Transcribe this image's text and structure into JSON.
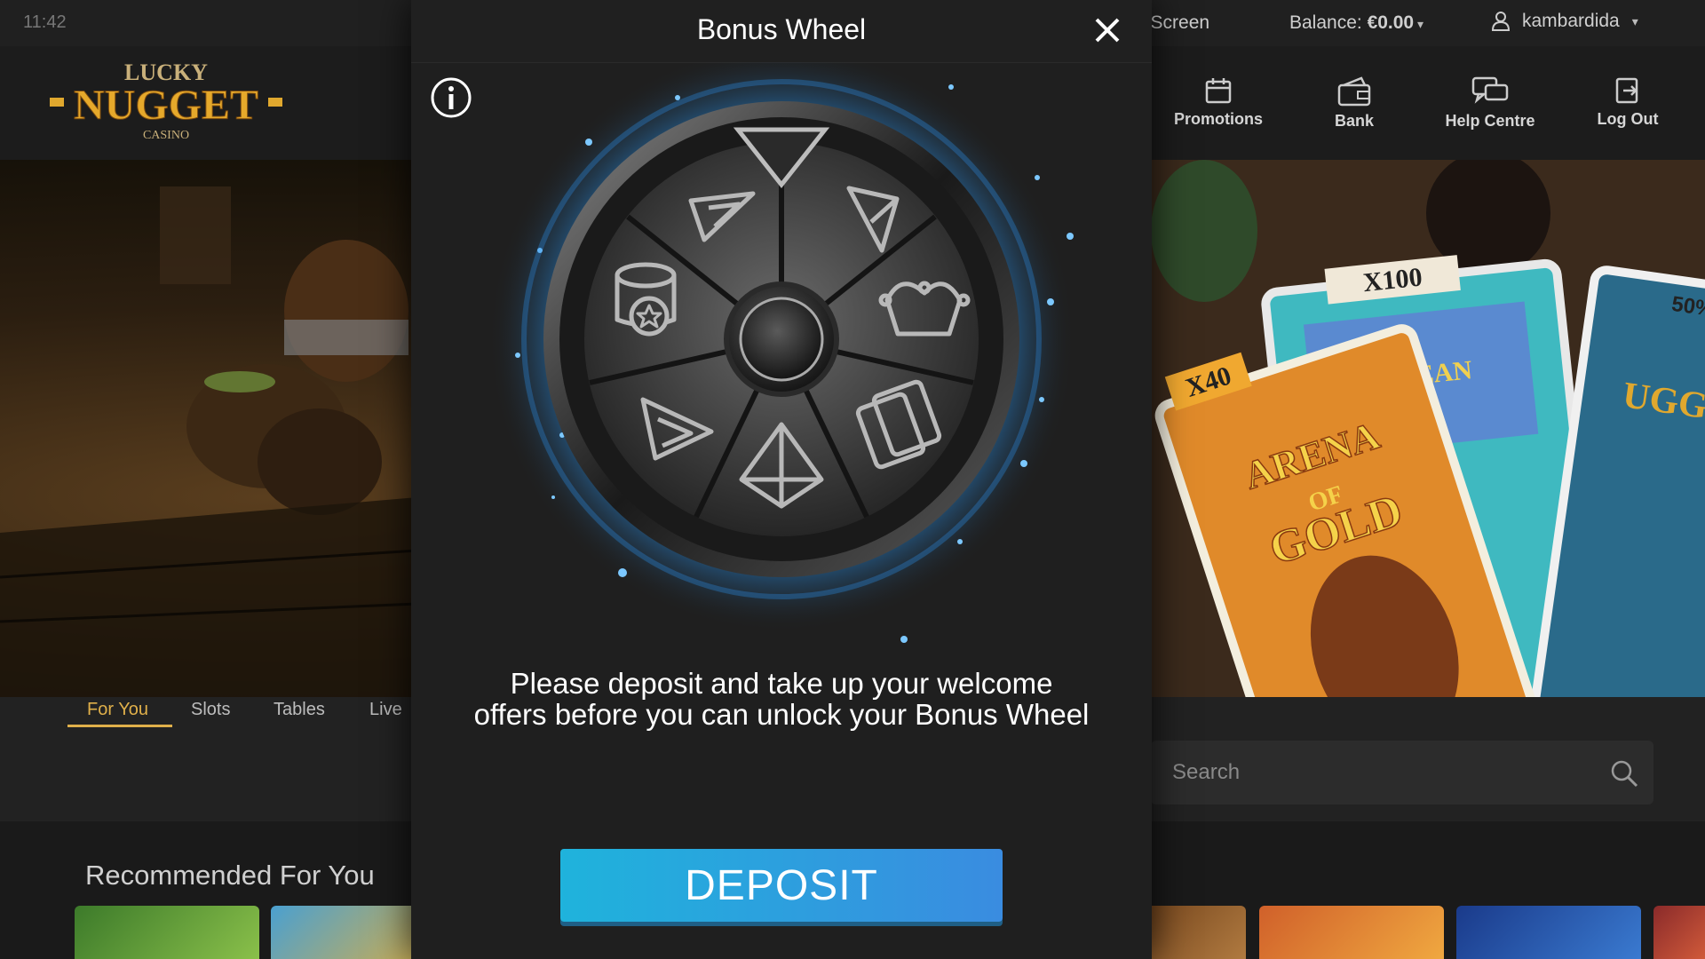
{
  "status_bar": {
    "time": "11:42"
  },
  "top_bar": {
    "screen_link": "e Screen",
    "balance_label": "Balance: ",
    "balance_value": "€0.00",
    "username": "kambardida"
  },
  "logo": {
    "line1": "LUCKY",
    "line2": "NUGGET",
    "line3": "CASINO"
  },
  "nav": {
    "promotions": "Promotions",
    "bank": "Bank",
    "help": "Help Centre",
    "logout": "Log Out"
  },
  "tabs": [
    "For You",
    "Slots",
    "Tables",
    "Live"
  ],
  "search": {
    "placeholder": "Search"
  },
  "recommended": {
    "title": "Recommended For You"
  },
  "modal": {
    "title": "Bonus Wheel",
    "message": "Please deposit and take up your welcome offers before you can unlock your Bonus Wheel",
    "deposit_label": "DEPOSIT"
  },
  "wheel": {
    "segments": [
      "diamond-icon",
      "jester-icon",
      "cards-icon",
      "gem-icon",
      "arrow-icon",
      "coin-stack-icon",
      "arrow-icon"
    ]
  },
  "colors": {
    "accent_gold": "#e0b04a",
    "deposit_start": "#1fb3dc",
    "deposit_end": "#3a8ce0",
    "glow": "#2a9dff"
  }
}
